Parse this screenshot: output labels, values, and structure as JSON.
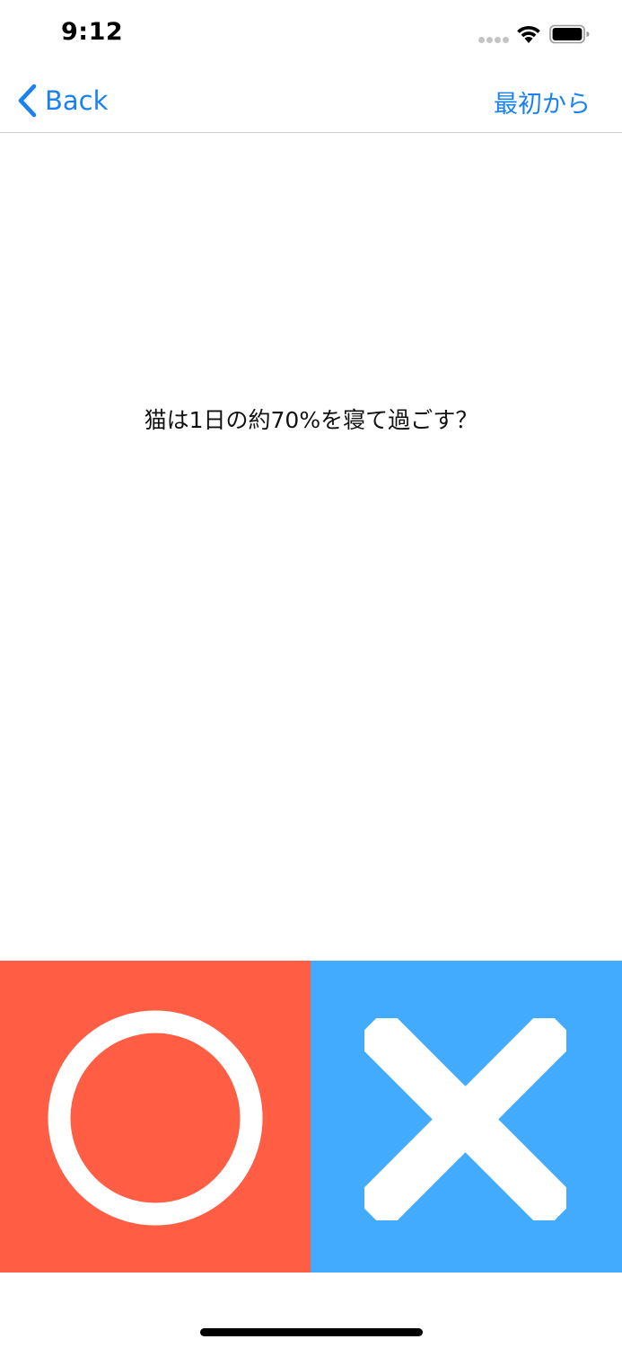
{
  "status_bar": {
    "time": "9:12",
    "icons": [
      "signal-dots-icon",
      "wifi-icon",
      "battery-icon"
    ]
  },
  "nav": {
    "back_label": "Back",
    "restart_label": "最初から",
    "back_icon": "chevron-left-icon"
  },
  "question": {
    "text": "猫は1日の約70%を寝て過ごす？"
  },
  "answers": {
    "true_icon": "circle-icon",
    "false_icon": "cross-icon"
  },
  "colors": {
    "accent": "#1a82f0",
    "true_button": "#ff5e45",
    "false_button": "#42abfd",
    "icon_fill": "#ffffff"
  }
}
